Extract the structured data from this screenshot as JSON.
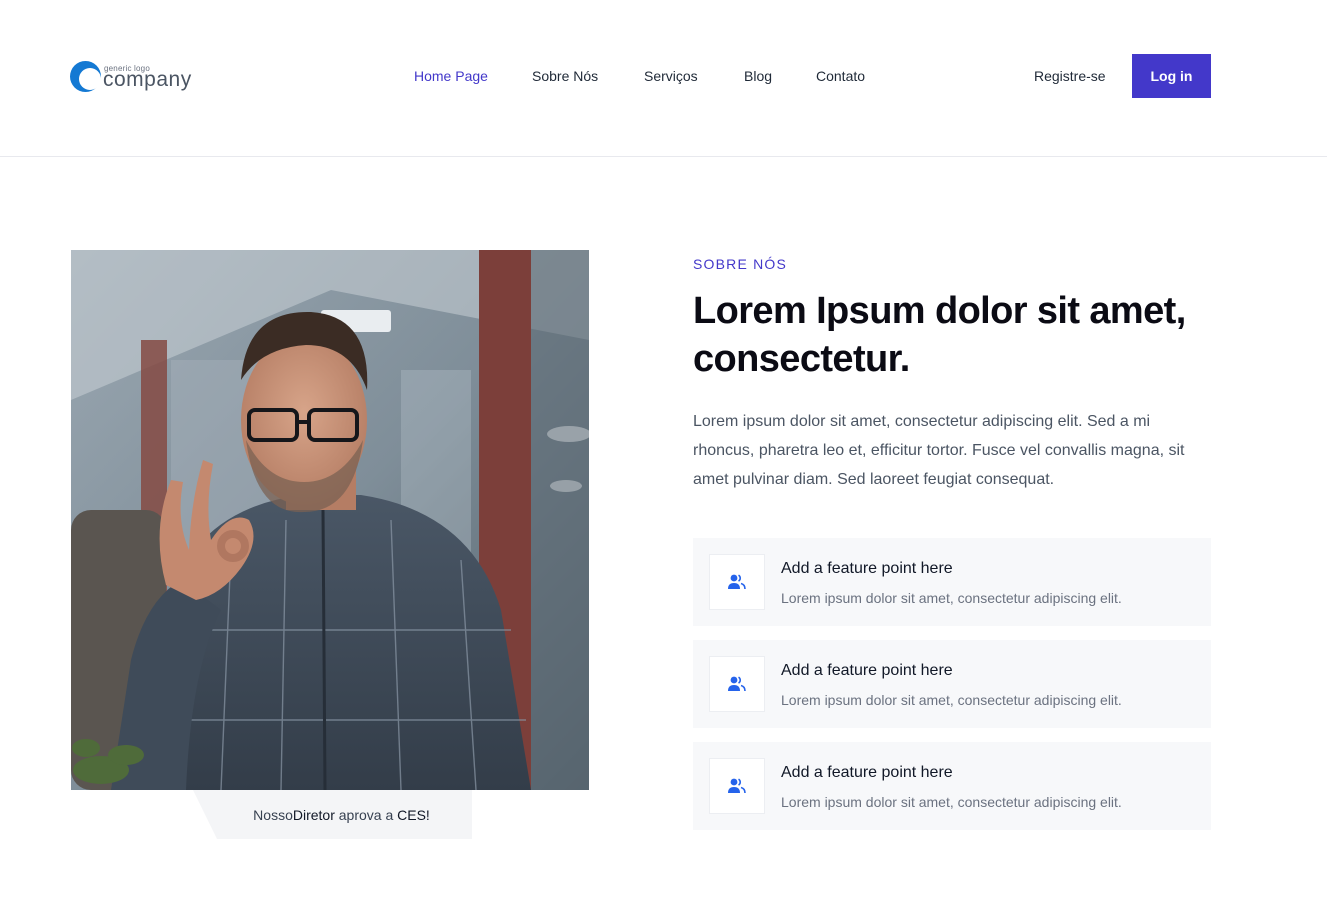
{
  "brand": {
    "logo_small": "generic logo",
    "logo_big": "company",
    "accent": "#4338ca"
  },
  "nav": {
    "items": [
      {
        "label": "Home Page",
        "active": true
      },
      {
        "label": "Sobre Nós",
        "active": false
      },
      {
        "label": "Serviços",
        "active": false
      },
      {
        "label": "Blog",
        "active": false
      },
      {
        "label": "Contato",
        "active": false
      }
    ],
    "register": "Registre-se",
    "login": "Log in"
  },
  "about": {
    "eyebrow": "SOBRE NÓS",
    "headline": "Lorem Ipsum dolor sit amet, consectetur.",
    "paragraph": "Lorem ipsum dolor sit amet, consectetur adipiscing elit. Sed a mi rhoncus, pharetra leo et, efficitur tortor. Fusce vel convallis magna, sit amet pulvinar diam. Sed laoreet feugiat consequat.",
    "caption": {
      "prefix": "Nosso ",
      "bold1": "Diretor",
      "middle": " aprova a ",
      "bold2": "CES!"
    },
    "features": [
      {
        "icon": "users-icon",
        "title": "Add a feature point here",
        "desc": "Lorem ipsum dolor sit amet, consectetur adipiscing elit."
      },
      {
        "icon": "users-icon",
        "title": "Add a feature point here",
        "desc": "Lorem ipsum dolor sit amet, consectetur adipiscing elit."
      },
      {
        "icon": "users-icon",
        "title": "Add a feature point here",
        "desc": "Lorem ipsum dolor sit amet, consectetur adipiscing elit."
      }
    ]
  }
}
